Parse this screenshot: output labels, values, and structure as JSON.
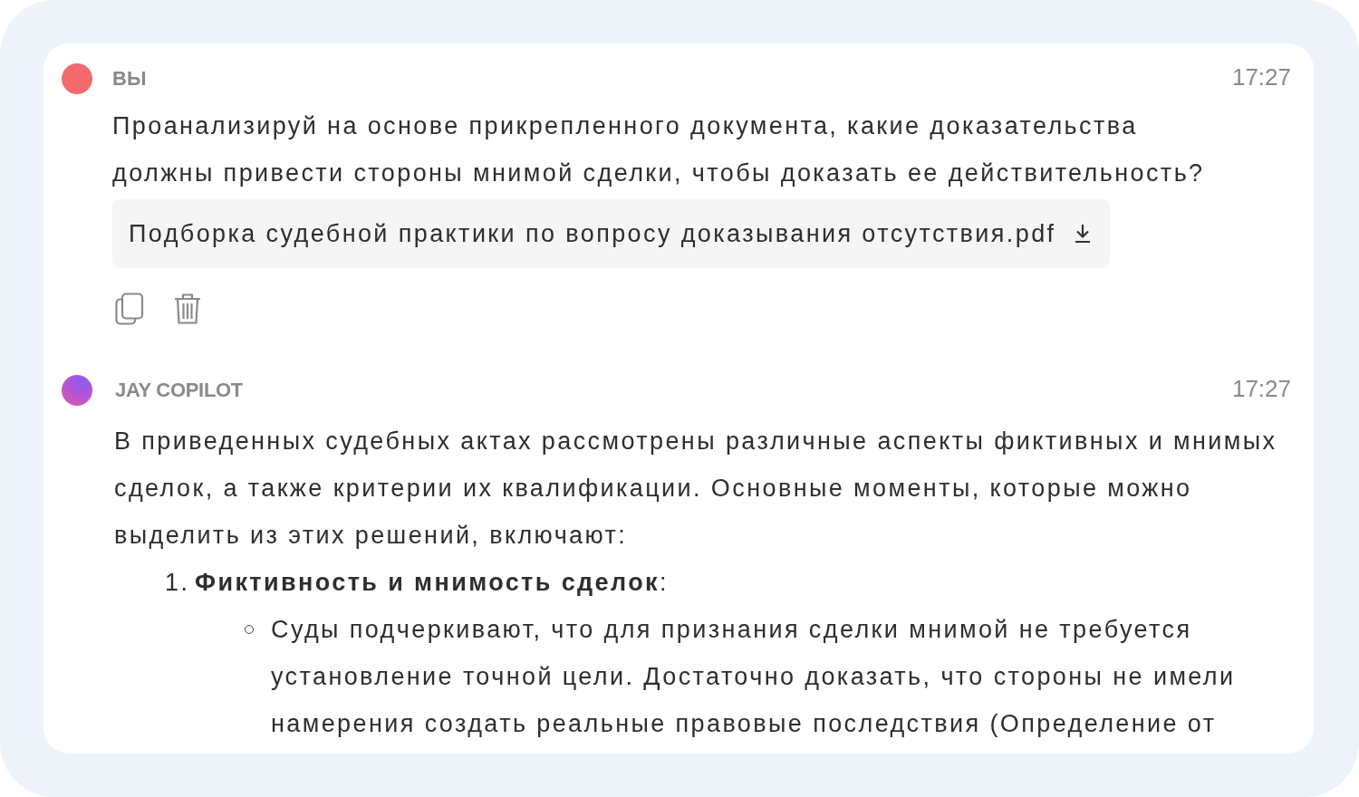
{
  "messages": [
    {
      "kind": "user",
      "author": "ВЫ",
      "time": "17:27",
      "blocks": [
        {
          "kind": "paragraph",
          "text": "Проанализируй на основе прикрепленного документа, какие доказательства\nдолжны привести стороны мнимой сделки, чтобы доказать ее действительность?"
        }
      ],
      "attachment": {
        "name": "Подборка судебной практики по вопросу доказывания отсутствия.pdf"
      }
    },
    {
      "kind": "assistant",
      "author": "JAY COPILOT",
      "time": "17:27",
      "blocks": [
        {
          "kind": "paragraph",
          "text": "В приведенных судебных актах рассмотрены различные аспекты фиктивных и мнимых\nсделок, а также критерии их квалификации. Основные моменты, которые можно\nвыделить из этих решений, включают:"
        },
        {
          "kind": "ordered_item",
          "number": "1.",
          "text": "**Фиктивность и мнимость сделок**:",
          "children": [
            {
              "kind": "bullet_item",
              "text": "Суды подчеркивают, что для признания сделки мнимой не требуется\nустановление точной цели. Достаточно доказать, что стороны не имели\nнамерения создать реальные правовые последствия (Определение от"
            }
          ]
        }
      ]
    }
  ]
}
